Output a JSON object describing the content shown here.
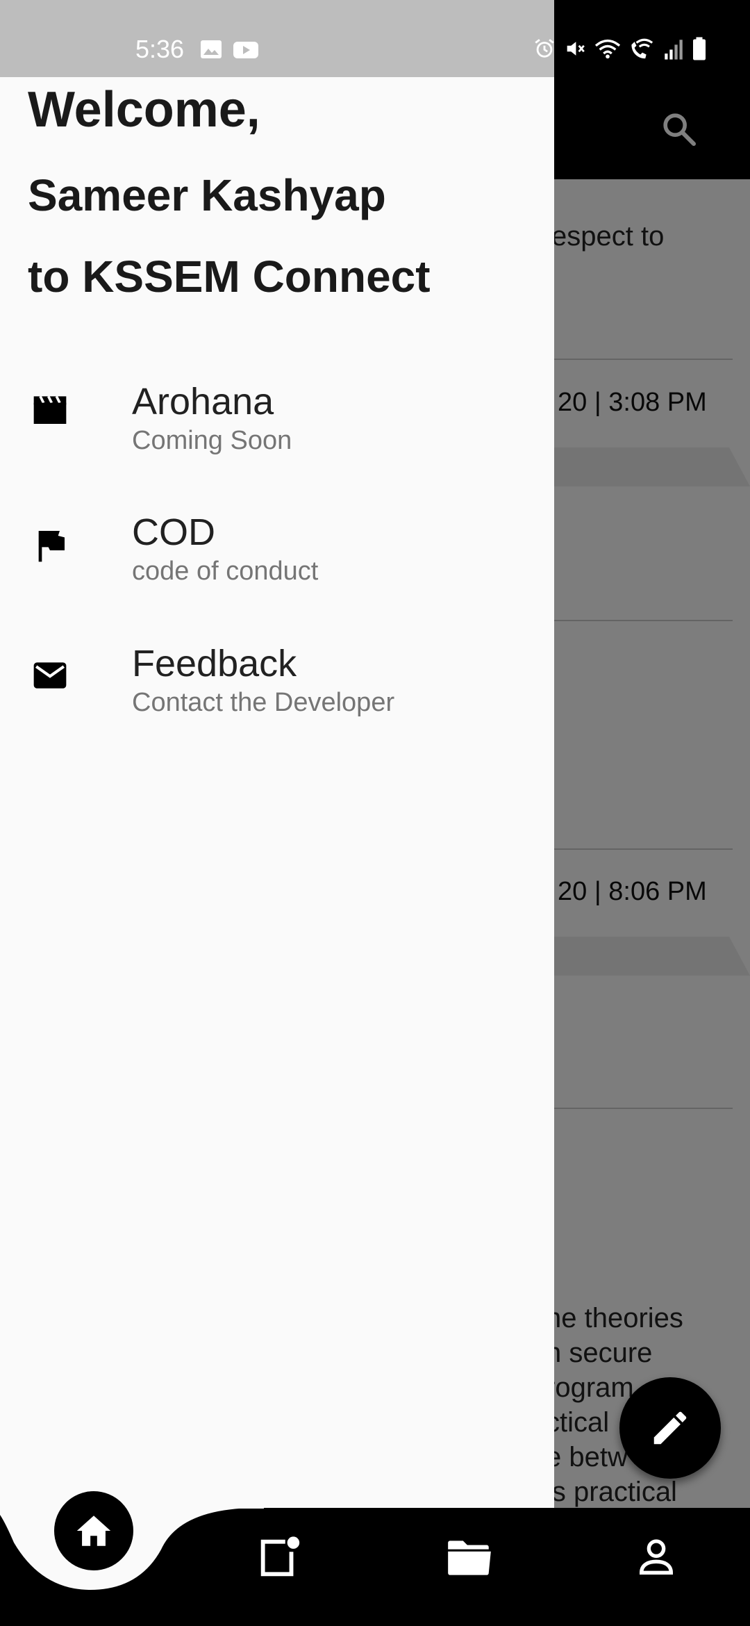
{
  "status_bar": {
    "time": "5:36",
    "left_icons": [
      "image-icon",
      "youtube-icon"
    ],
    "right_icons": [
      "alarm-icon",
      "mute-icon",
      "wifi-icon",
      "wifi-call-icon",
      "signal-icon",
      "battery-icon"
    ]
  },
  "background_feed": {
    "snippet_1": "espect to",
    "date_1": "20 | 3:08 PM",
    "date_2": "20 | 8:06 PM",
    "paragraph_lines": [
      "he theories",
      "n secure",
      "rogram",
      "ctical",
      "e betw",
      "is practical"
    ]
  },
  "drawer": {
    "welcome": "Welcome,",
    "user_name": "Sameer Kashyap",
    "to_app": "to KSSEM Connect",
    "items": [
      {
        "title": "Arohana",
        "subtitle": "Coming Soon",
        "icon": "clapperboard-icon"
      },
      {
        "title": "COD",
        "subtitle": "code of conduct",
        "icon": "flag-icon"
      },
      {
        "title": "Feedback",
        "subtitle": "Contact the Developer",
        "icon": "mail-icon"
      }
    ]
  },
  "bottom_nav": {
    "items": [
      "home-icon",
      "notes-icon",
      "folder-icon",
      "profile-icon"
    ],
    "active": "home-icon"
  },
  "fab": {
    "icon": "pencil-icon"
  },
  "colors": {
    "drawer_bg": "#fafafa",
    "app_bar": "#000000",
    "status_bar_overlay": "#bdbdbd",
    "text_primary": "#212121",
    "text_secondary": "#757575"
  }
}
